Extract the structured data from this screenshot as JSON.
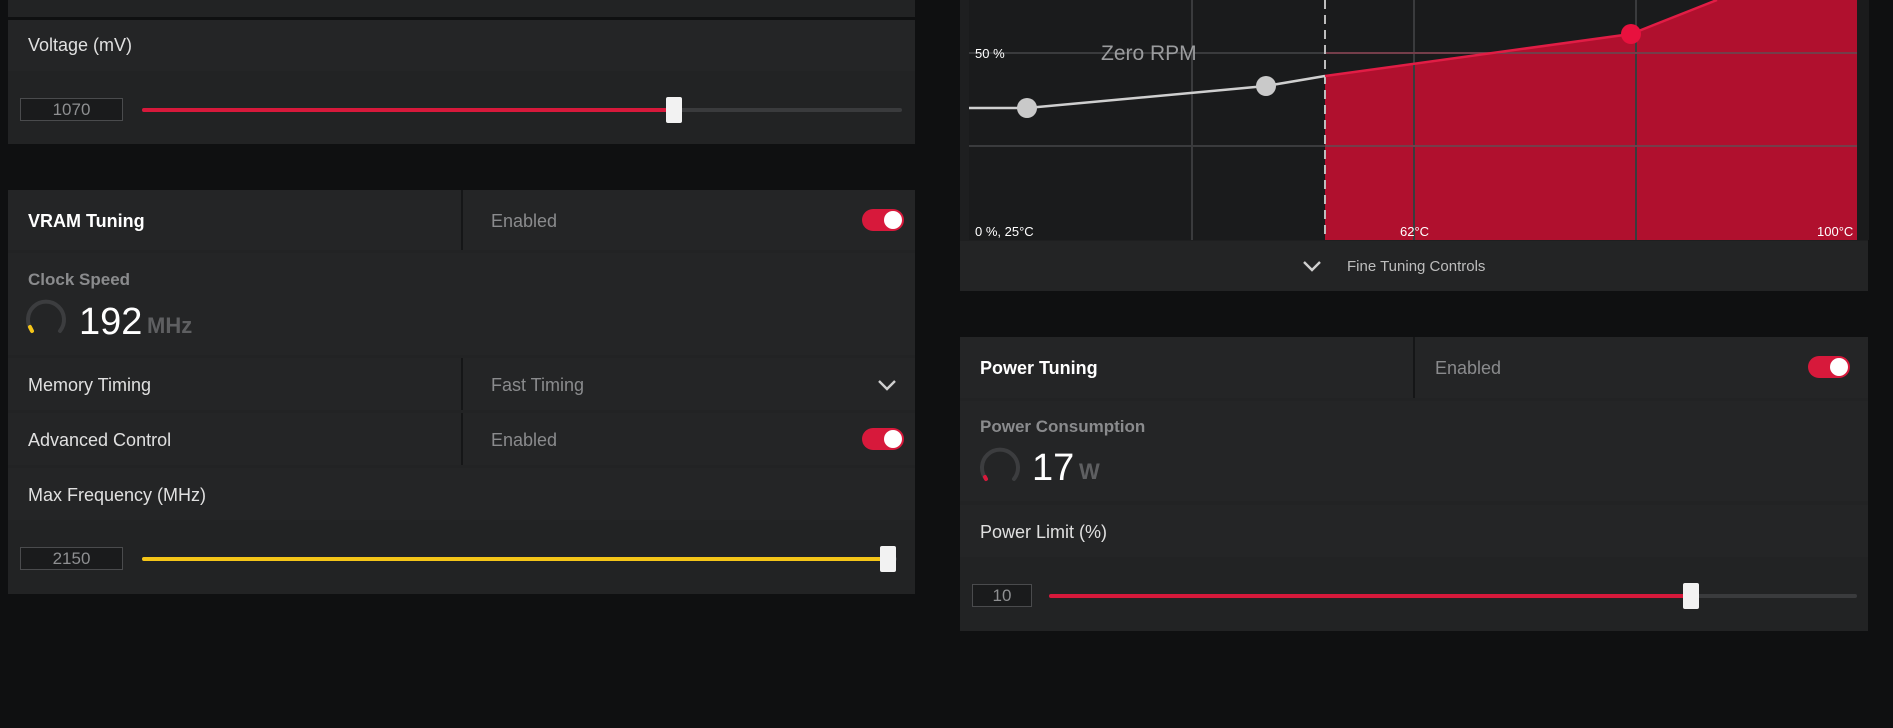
{
  "voltage": {
    "label": "Voltage (mV)",
    "value": "1070",
    "slider_fraction": 0.7,
    "accent": "#d7193b"
  },
  "vram": {
    "title": "VRAM Tuning",
    "status": "Enabled",
    "toggle_on": true,
    "clock_label": "Clock Speed",
    "clock_value": "192",
    "clock_unit": "MHz",
    "memory_timing_label": "Memory Timing",
    "memory_timing_value": "Fast Timing",
    "advanced_label": "Advanced Control",
    "advanced_status": "Enabled",
    "max_freq_label": "Max Frequency (MHz)",
    "max_freq_value": "2150",
    "max_freq_fraction": 1.0,
    "slider_color": "#f5c518"
  },
  "fan_chart": {
    "y_label": "50 %",
    "zero_rpm": "Zero RPM",
    "origin_label": "0 %, 25°C",
    "mid_label": "62°C",
    "max_label": "100°C",
    "fine_tuning": "Fine Tuning Controls"
  },
  "power": {
    "title": "Power Tuning",
    "status": "Enabled",
    "toggle_on": true,
    "consumption_label": "Power Consumption",
    "consumption_value": "17",
    "consumption_unit": "W",
    "limit_label": "Power Limit (%)",
    "limit_value": "10",
    "limit_fraction": 0.8
  },
  "icons": {
    "chevron": "chevron-down-icon",
    "gauge": "gauge-icon"
  }
}
